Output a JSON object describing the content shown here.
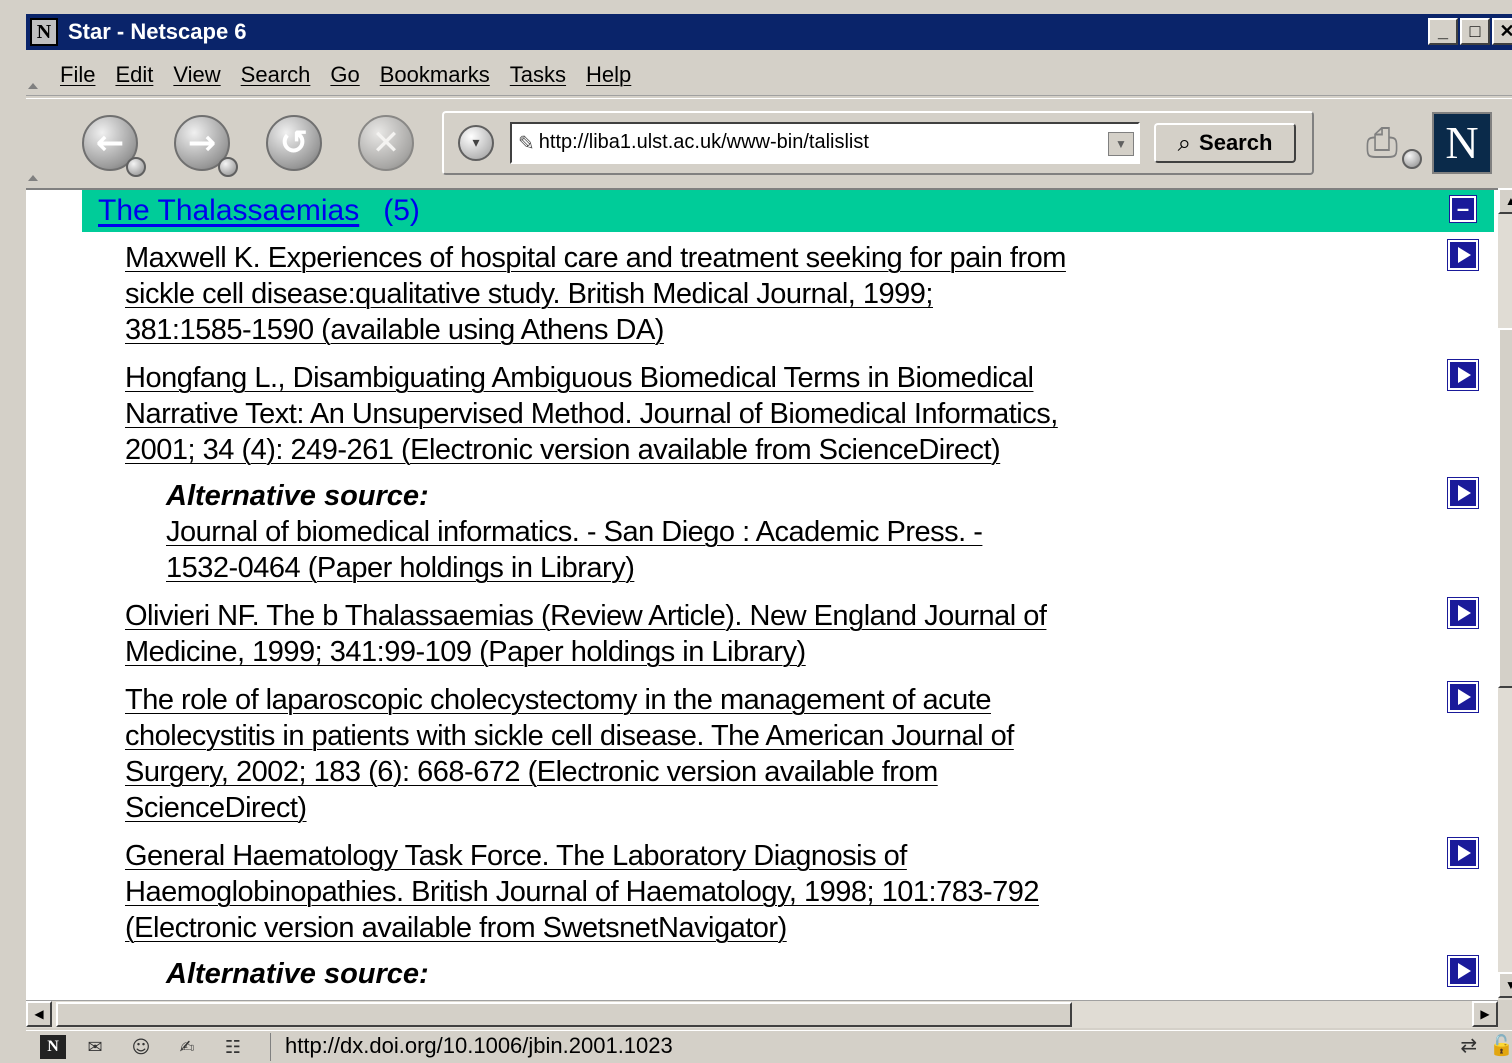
{
  "window": {
    "title": "Star - Netscape 6",
    "app_icon_glyph": "N",
    "controls": [
      "_",
      "□",
      "✕"
    ]
  },
  "menu": [
    "File",
    "Edit",
    "View",
    "Search",
    "Go",
    "Bookmarks",
    "Tasks",
    "Help"
  ],
  "toolbar": {
    "back_icon": "back-arrow-icon",
    "forward_icon": "forward-arrow-icon",
    "reload_icon": "reload-icon",
    "stop_icon": "stop-icon",
    "url": "http://liba1.ulst.ac.uk/www-bin/talislist",
    "search_label": "Search",
    "throbber_glyph": "N"
  },
  "content": {
    "section": {
      "title": "The Thalassaemias",
      "count": "(5)"
    },
    "references": [
      {
        "lines": [
          "Maxwell K. Experiences of hospital care and treatment seeking for pain from",
          "sickle cell disease:qualitative study. British Medical Journal, 1999;",
          "381:1585-1590 (available using Athens DA)"
        ]
      },
      {
        "lines": [
          "Hongfang L., Disambiguating Ambiguous Biomedical Terms in Biomedical",
          "Narrative Text: An Unsupervised Method. Journal of Biomedical Informatics,",
          "2001; 34 (4): 249-261 (Electronic version available from ScienceDirect)"
        ],
        "alternative_label": "Alternative source:",
        "alternative_lines": [
          "Journal of biomedical informatics. - San Diego : Academic Press. -",
          "1532-0464 (Paper holdings in Library)"
        ]
      },
      {
        "lines": [
          "Olivieri NF. The b Thalassaemias (Review Article). New England Journal of",
          "Medicine, 1999; 341:99-109 (Paper holdings in Library)"
        ]
      },
      {
        "lines": [
          "The role of laparoscopic cholecystectomy in the management of acute",
          "cholecystitis in patients with sickle cell disease. The American Journal of",
          "Surgery, 2002; 183 (6): 668-672 (Electronic version available from",
          "ScienceDirect)"
        ]
      },
      {
        "lines": [
          "General Haematology Task Force. The Laboratory Diagnosis of",
          "Haemoglobinopathies. British Journal of Haematology, 1998; 101:783-792",
          "(Electronic version available from SwetsnetNavigator)"
        ],
        "alternative_label": "Alternative source:"
      }
    ]
  },
  "status": {
    "text": "http://dx.doi.org/10.1006/jbin.2001.1023"
  },
  "colors": {
    "titlebar": "#0a246a",
    "section_header": "#00cc99",
    "link": "#0000ee",
    "play_button": "#1a1a9a"
  }
}
